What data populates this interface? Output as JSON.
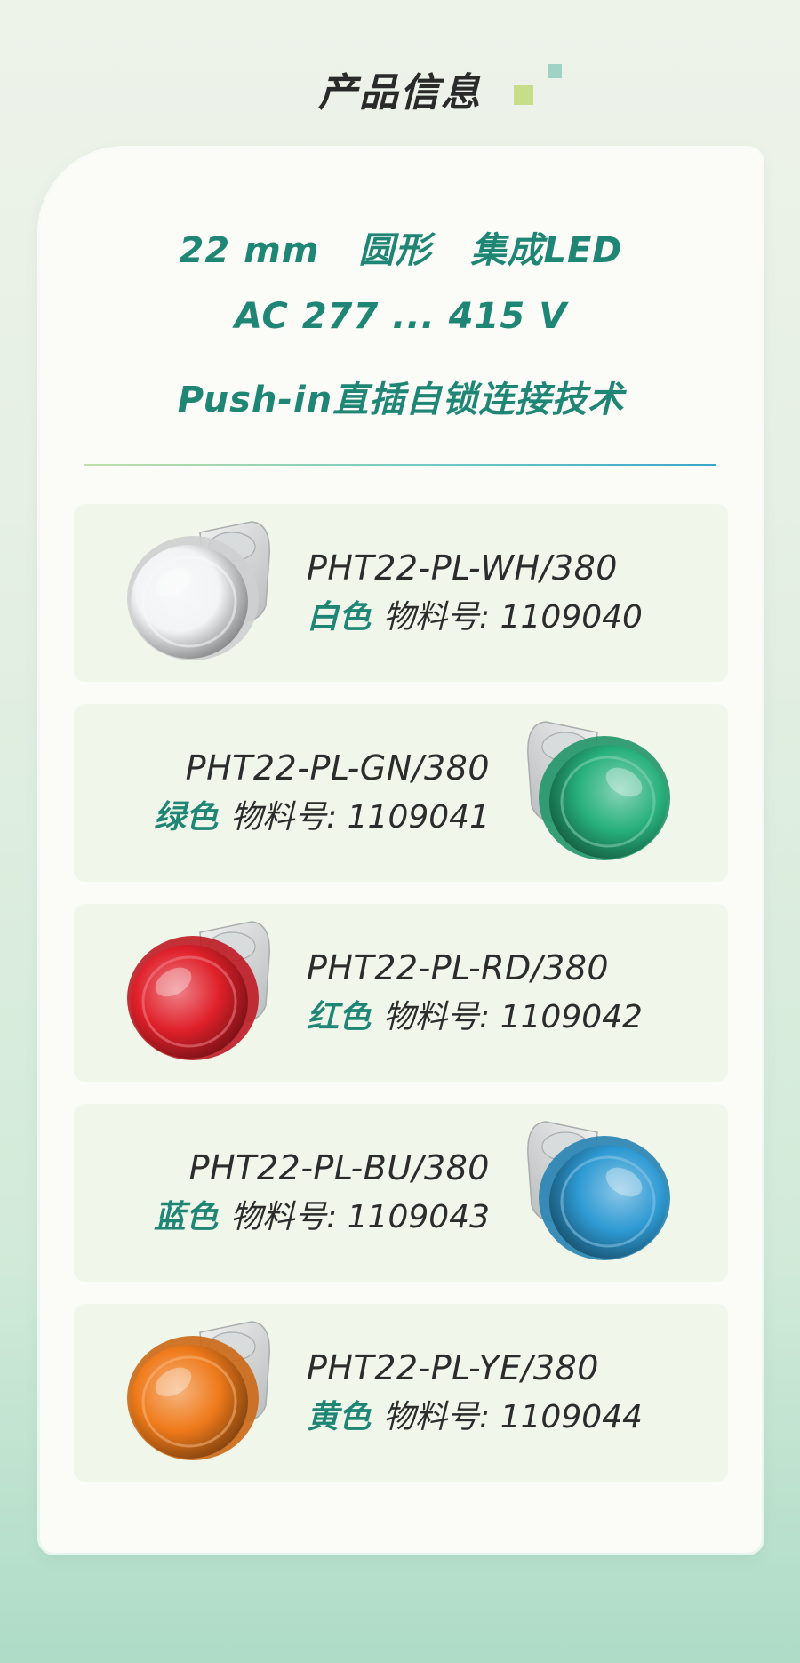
{
  "header": {
    "title": "产品信息"
  },
  "specs": {
    "line1": [
      "22 mm",
      "圆形",
      "集成LED"
    ],
    "line2": "AC 277 ... 415 V",
    "line3": "Push-in直插自锁连接技术"
  },
  "products": [
    {
      "model": "PHT22-PL-WH/380",
      "color_name": "白色",
      "material_label": "物料号:",
      "material_no": "1109040",
      "lens_color": "#f2f4f5",
      "icon": "white-indicator-lamp-icon"
    },
    {
      "model": "PHT22-PL-GN/380",
      "color_name": "绿色",
      "material_label": "物料号:",
      "material_no": "1109041",
      "lens_color": "#27b07c",
      "icon": "green-indicator-lamp-icon"
    },
    {
      "model": "PHT22-PL-RD/380",
      "color_name": "红色",
      "material_label": "物料号:",
      "material_no": "1109042",
      "lens_color": "#e0202a",
      "icon": "red-indicator-lamp-icon"
    },
    {
      "model": "PHT22-PL-BU/380",
      "color_name": "蓝色",
      "material_label": "物料号:",
      "material_no": "1109043",
      "lens_color": "#2e9ad3",
      "icon": "blue-indicator-lamp-icon"
    },
    {
      "model": "PHT22-PL-YE/380",
      "color_name": "黄色",
      "material_label": "物料号:",
      "material_no": "1109044",
      "lens_color": "#ef7a1a",
      "icon": "yellow-indicator-lamp-icon"
    }
  ],
  "colors": {
    "accent": "#1f8676",
    "text_dark": "#2c2c2c",
    "card_bg": "#fbfcf7",
    "row_bg": "#f1f6ea"
  }
}
